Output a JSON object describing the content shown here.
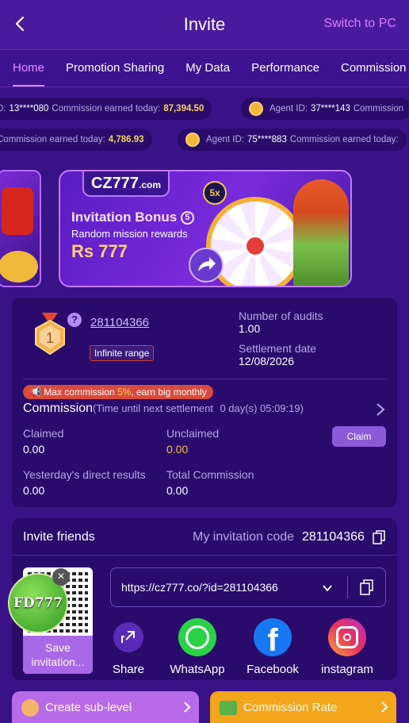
{
  "header": {
    "title": "Invite",
    "switch_label": "Switch to PC"
  },
  "tabs": [
    "Home",
    "Promotion Sharing",
    "My Data",
    "Performance",
    "Commission"
  ],
  "ticker": {
    "row1": [
      {
        "prefix": "D:",
        "id": "13****080",
        "label": "Commission earned today:",
        "amount": "87,394.50"
      },
      {
        "prefix": "Agent ID:",
        "id": "37****143",
        "label": "Commission",
        "amount": ""
      }
    ],
    "row2": [
      {
        "prefix": "",
        "id": "",
        "label": "Commission earned today:",
        "amount": "4,786.93"
      },
      {
        "prefix": "Agent ID:",
        "id": "75****883",
        "label": "Commission earned today:",
        "amount": ""
      }
    ]
  },
  "banner": {
    "logo": "CZ777",
    "logo_suffix": ".com",
    "title": "Invitation Bonus",
    "title_badge": "5",
    "subtitle": "Random mission rewards",
    "amount": "Rs 777",
    "multiplier": "5x"
  },
  "agent": {
    "level": "1",
    "id": "281104366",
    "range_label": "Infinite range",
    "audits_label": "Number of audits",
    "audits_value": "1.00",
    "settlement_label": "Settlement date",
    "settlement_value": "12/08/2026",
    "max_commission_prefix": "Max commission",
    "max_commission_value": "5%",
    "max_commission_suffix": ", earn big monthly",
    "commission_title": "Commission",
    "countdown_label": "(Time until next settlement",
    "countdown_value": "0 day(s) 05:09:19)",
    "claimed_label": "Claimed",
    "claimed_value": "0.00",
    "unclaimed_label": "Unclaimed",
    "unclaimed_value": "0.00",
    "claim_button": "Claim",
    "yesterday_label": "Yesterday's direct results",
    "yesterday_value": "0.00",
    "total_label": "Total Commission",
    "total_value": "0.00"
  },
  "invite": {
    "title": "Invite friends",
    "code_label": "My invitation code",
    "code_value": "281104366",
    "link": "https://cz777.co/?id=281104366",
    "save_label": "Save invitation...",
    "share_label": "Share",
    "whatsapp_label": "WhatsApp",
    "facebook_label": "Facebook",
    "instagram_label": "instagram",
    "float_badge": "FD777"
  },
  "bottom": {
    "sub_level": "Create sub-level",
    "commission_rate": "Commission Rate"
  },
  "colors": {
    "accent": "#e58cff",
    "gold": "#f5d35b",
    "card": "#2a0b6c"
  }
}
